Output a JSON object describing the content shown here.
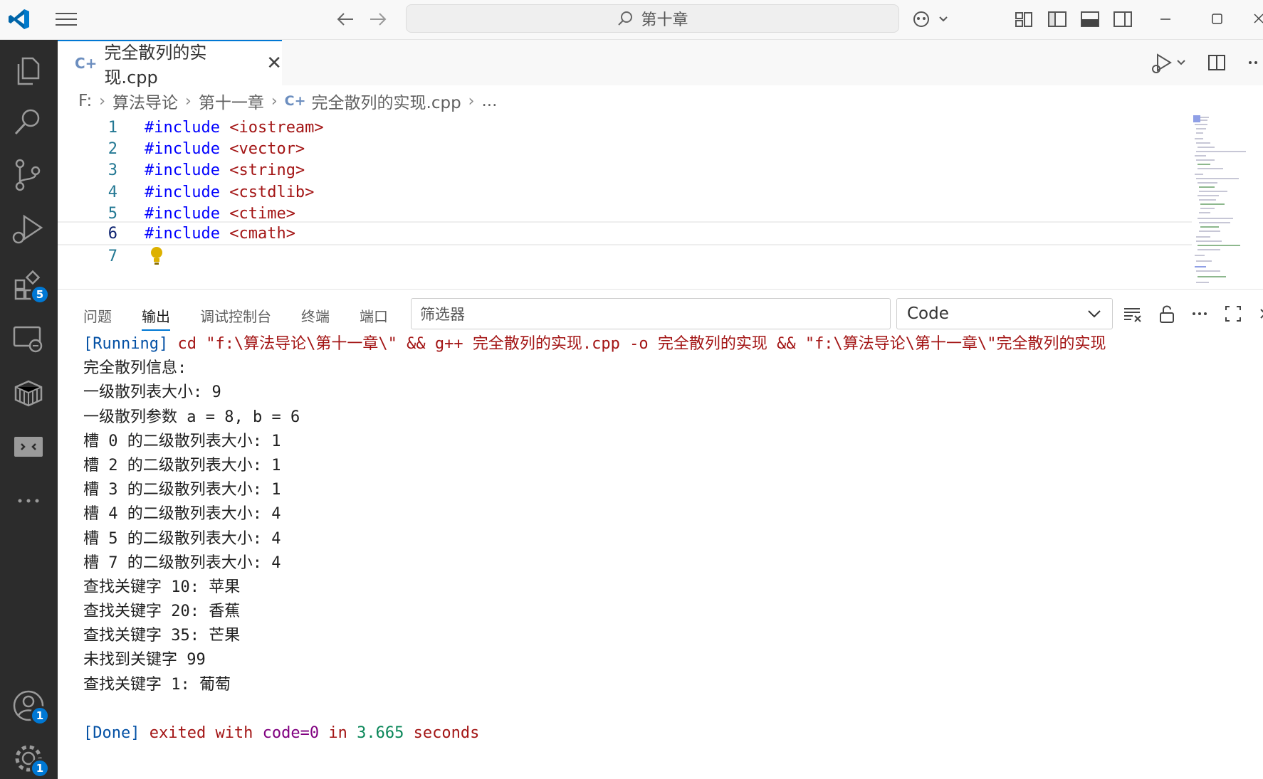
{
  "titlebar": {
    "search_text": "第十章"
  },
  "activity": {
    "extensions_badge": "5",
    "accounts_badge": "1",
    "settings_badge": "1"
  },
  "tab": {
    "filename": "完全散列的实现.cpp",
    "close": "✕"
  },
  "breadcrumb": {
    "drive": "F:",
    "folder1": "算法导论",
    "folder2": "第十一章",
    "file": "完全散列的实现.cpp",
    "more": "..."
  },
  "code_lines": [
    {
      "num": "1",
      "kw": "#include",
      "arg": "<iostream>"
    },
    {
      "num": "2",
      "kw": "#include",
      "arg": "<vector>"
    },
    {
      "num": "3",
      "kw": "#include",
      "arg": "<string>"
    },
    {
      "num": "4",
      "kw": "#include",
      "arg": "<cstdlib>"
    },
    {
      "num": "5",
      "kw": "#include",
      "arg": "<ctime>"
    },
    {
      "num": "6",
      "kw": "#include",
      "arg": "<cmath>"
    },
    {
      "num": "7",
      "kw": "",
      "arg": ""
    }
  ],
  "panel": {
    "tabs": [
      "问题",
      "输出",
      "调试控制台",
      "终端",
      "端口"
    ],
    "active_tab": "输出",
    "filter_placeholder": "筛选器",
    "channel": "Code"
  },
  "output": {
    "running_tag": "[Running]",
    "running_cmd": " cd \"f:\\算法导论\\第十一章\\\" && g++ 完全散列的实现.cpp -o 完全散列的实现 && \"f:\\算法导论\\第十一章\\\"完全散列的实现",
    "lines": [
      "完全散列信息:",
      "一级散列表大小: 9",
      "一级散列参数 a = 8, b = 6",
      "槽 0 的二级散列表大小: 1",
      "槽 2 的二级散列表大小: 1",
      "槽 3 的二级散列表大小: 1",
      "槽 4 的二级散列表大小: 4",
      "槽 5 的二级散列表大小: 4",
      "槽 7 的二级散列表大小: 4",
      "查找关键字 10: 苹果",
      "查找关键字 20: 香蕉",
      "查找关键字 35: 芒果",
      "未找到关键字 99",
      "查找关键字 1: 葡萄"
    ],
    "done_tag": "[Done]",
    "done_text1": " exited with ",
    "done_code": "code=0",
    "done_text2": " in ",
    "done_time": "3.665",
    "done_text3": " seconds"
  },
  "colors": {
    "accent": "#0078d4",
    "activitybar": "#2c2c2c",
    "keyword": "#0000ff",
    "string": "#a31515"
  }
}
